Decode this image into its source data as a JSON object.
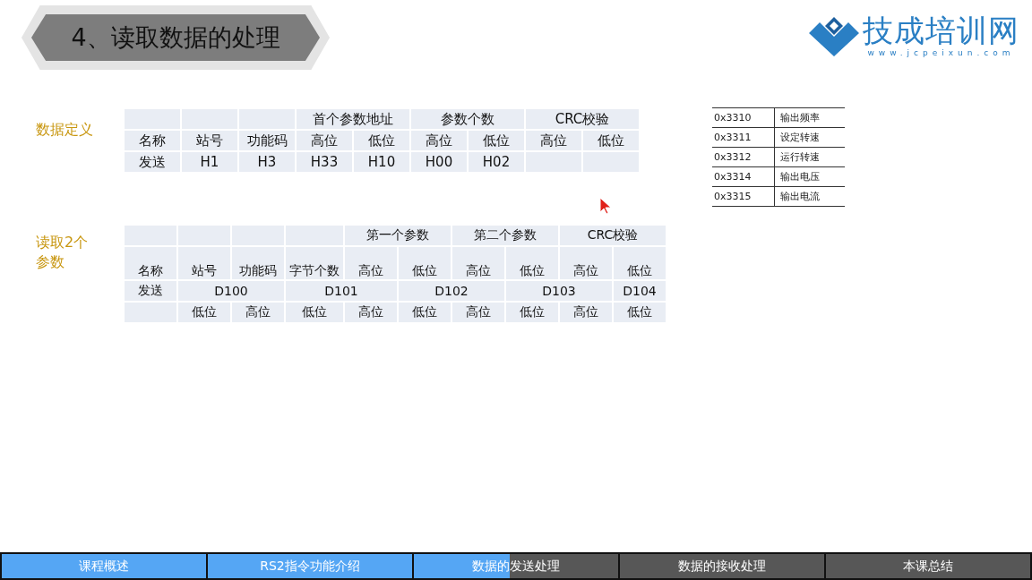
{
  "title": "4、读取数据的处理",
  "logo": {
    "name": "技成培训网",
    "url": "www.jcpeixun.com"
  },
  "sections": [
    {
      "label": "数据定义",
      "rows": [
        [
          {},
          {},
          {},
          {
            "text": "首个参数地址",
            "colspan": 2
          },
          {
            "text": "参数个数",
            "colspan": 2
          },
          {
            "text": "CRC校验",
            "colspan": 2
          }
        ],
        [
          {
            "text": "名称"
          },
          {
            "text": "站号"
          },
          {
            "text": "功能码"
          },
          {
            "text": "高位"
          },
          {
            "text": "低位"
          },
          {
            "text": "高位"
          },
          {
            "text": "低位"
          },
          {
            "text": "高位"
          },
          {
            "text": "低位"
          }
        ],
        [
          {
            "text": "发送"
          },
          {
            "text": "H1"
          },
          {
            "text": "H3"
          },
          {
            "text": "H33"
          },
          {
            "text": "H10"
          },
          {
            "text": "H00"
          },
          {
            "text": "H02"
          },
          {},
          {}
        ]
      ]
    },
    {
      "label": "读取2个参数",
      "rows": [
        [
          {},
          {},
          {},
          {},
          {
            "text": "第一个参数",
            "colspan": 2
          },
          {
            "text": "第二个参数",
            "colspan": 2
          },
          {
            "text": "CRC校验",
            "colspan": 2
          }
        ],
        [
          {
            "text": "名称"
          },
          {
            "text": "站号"
          },
          {
            "text": "功能码"
          },
          {
            "text": "字节个数"
          },
          {
            "text": "高位"
          },
          {
            "text": "低位"
          },
          {
            "text": "高位"
          },
          {
            "text": "低位"
          },
          {
            "text": "高位"
          },
          {
            "text": "低位"
          }
        ],
        [
          {
            "text": "发送"
          },
          {
            "text": "D100",
            "colspan": 2
          },
          {
            "text": "D101",
            "colspan": 2
          },
          {
            "text": "D102",
            "colspan": 2
          },
          {
            "text": "D103",
            "colspan": 2
          },
          {
            "text": "D104"
          }
        ],
        [
          {},
          {
            "text": "低位"
          },
          {
            "text": "高位"
          },
          {
            "text": "低位"
          },
          {
            "text": "高位"
          },
          {
            "text": "低位"
          },
          {
            "text": "高位"
          },
          {
            "text": "低位"
          },
          {
            "text": "高位"
          },
          {
            "text": "低位"
          }
        ]
      ]
    }
  ],
  "registers": [
    {
      "address": "0x3310",
      "meaning": "输出频率"
    },
    {
      "address": "0x3311",
      "meaning": "设定转速"
    },
    {
      "address": "0x3312",
      "meaning": "运行转速"
    },
    {
      "address": "0x3314",
      "meaning": "输出电压"
    },
    {
      "address": "0x3315",
      "meaning": "输出电流"
    }
  ],
  "progress": {
    "level": 0.494
  },
  "nav": [
    {
      "label": "课程概述"
    },
    {
      "label": "RS2指令功能介绍"
    },
    {
      "label": "数据的发送处理"
    },
    {
      "label": "数据的接收处理"
    },
    {
      "label": "本课总结"
    }
  ]
}
